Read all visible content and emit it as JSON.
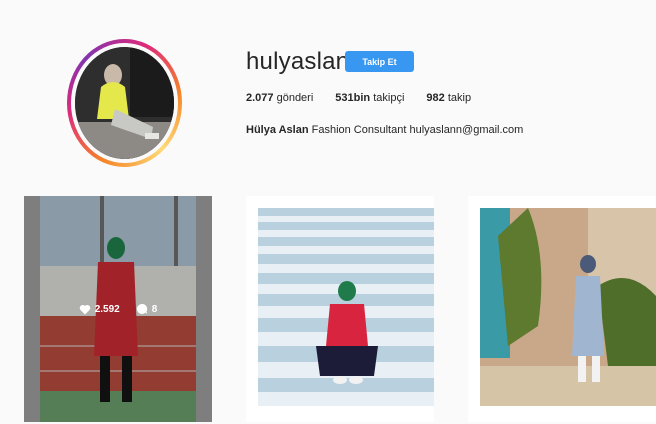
{
  "profile": {
    "username": "hulyaslan",
    "follow_label": "Takip Et",
    "stats": [
      {
        "count": "2.077",
        "label": " gönderi"
      },
      {
        "count": "531bin",
        "label": " takipçi"
      },
      {
        "count": "982",
        "label": " takip"
      }
    ],
    "bio_name": "Hülya Aslan",
    "bio_text": " Fashion Consultant hulyaslann@gmail.com"
  },
  "posts": [
    {
      "likes": "2.592",
      "comments": "8",
      "hovered": true
    },
    {
      "likes": "",
      "comments": "",
      "hovered": false
    },
    {
      "likes": "",
      "comments": "",
      "hovered": false
    }
  ],
  "colors": {
    "accent": "#3897f0",
    "background": "#fafafa"
  },
  "icons": [
    "heart-icon",
    "comment-icon"
  ]
}
